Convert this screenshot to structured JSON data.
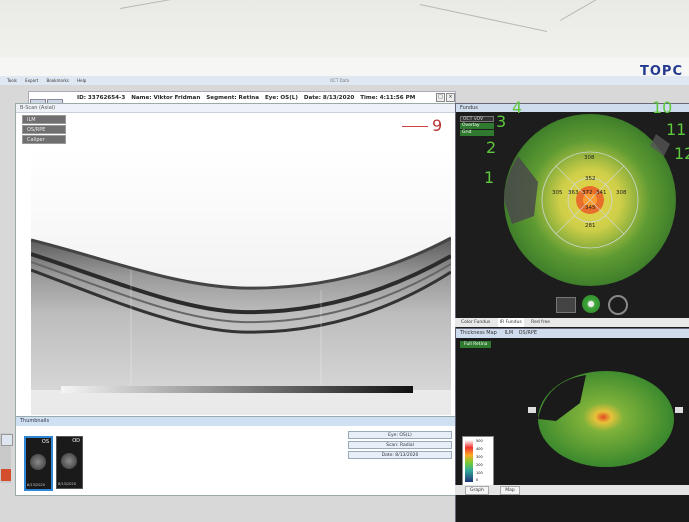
{
  "brand": {
    "logo_text": "TOPC"
  },
  "menu": {
    "items": [
      "Tools",
      "Export",
      "Bookmarks",
      "Help"
    ],
    "window_title": "OCT Data"
  },
  "patient": {
    "id": "ID: 33762654-3",
    "name": "Name: Viktor Fridman",
    "segment": "Segment: Retina",
    "eye": "Eye: OS(L)",
    "date": "Date: 8/13/2020",
    "time": "Time: 4:11:56 PM"
  },
  "bscan": {
    "title": "B-Scan (Axial)",
    "layer_buttons": [
      "ILM",
      "OS/RPE",
      "Caliper"
    ],
    "annotation_number": "9",
    "toolbar": {
      "zoom_value": "100",
      "spacing_value": "32"
    }
  },
  "thumbnails": {
    "title": "Thumbnails",
    "thumb_labels": [
      "OS",
      "OD"
    ],
    "thumb_dates": [
      "8/13/2020",
      "8/13/2020"
    ],
    "buttons": [
      "Eye: OS(L)",
      "Scan: Radial",
      "Date: 8/13/2020"
    ]
  },
  "fundus": {
    "title": "Fundus",
    "overlay_buttons": [
      "OCT vOV",
      "Overlay",
      "Grid"
    ],
    "grid_values": [
      "308",
      "352",
      "305",
      "363",
      "372",
      "341",
      "308",
      "345",
      "281"
    ],
    "handwritten_numbers": [
      "4",
      "3",
      "2",
      "1",
      "10",
      "11",
      "12"
    ],
    "tabs": [
      "Color Fundus",
      "IR Fundus",
      "Red free"
    ]
  },
  "thickness": {
    "title": "Thickness Map",
    "tabs": [
      "ILM",
      "OS/RPE"
    ],
    "subtitle": "Full Retina",
    "scale_values": [
      "500",
      "400",
      "300",
      "200",
      "100",
      "0"
    ],
    "bottom_tabs": [
      "Graph",
      "Map"
    ]
  },
  "colors": {
    "panel_bg": "#1a1a1a",
    "map_green": "#4f8a32",
    "accent_blue": "#cfdcee",
    "hand_green": "#5dc83d"
  }
}
